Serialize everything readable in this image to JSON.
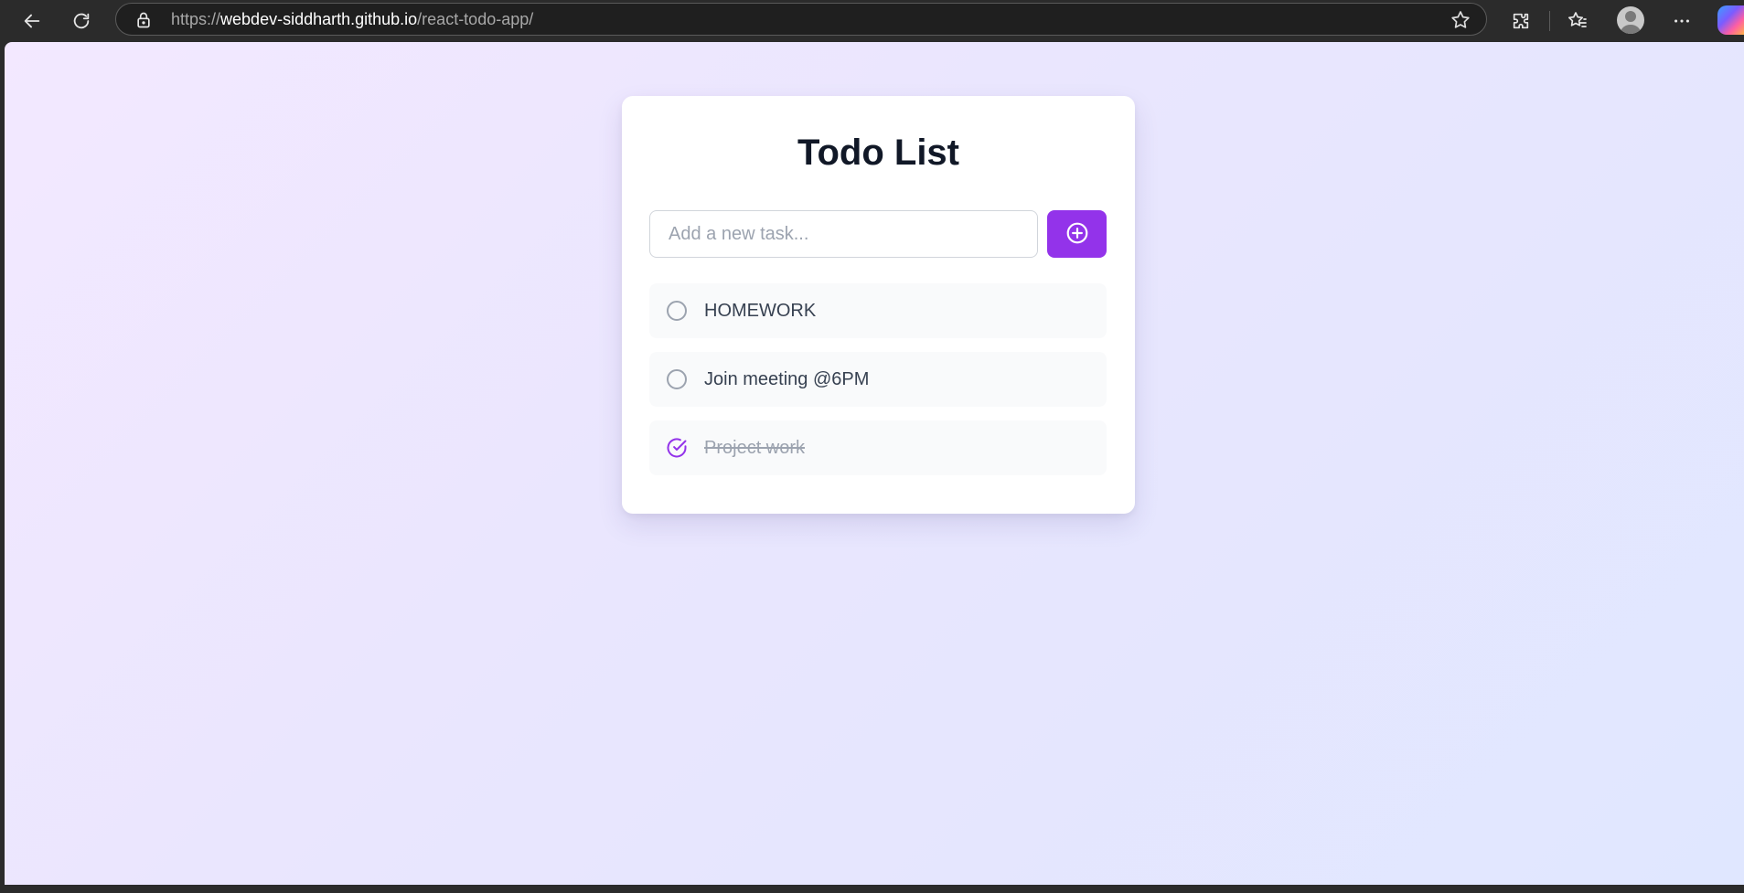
{
  "browser": {
    "url_scheme": "https://",
    "url_host": "webdev-siddharth.github.io",
    "url_path": "/react-todo-app/",
    "icons": [
      "back-icon",
      "refresh-icon",
      "lock-icon",
      "favorite-star-icon",
      "extensions-icon",
      "favorites-icon",
      "profile-avatar",
      "more-icon",
      "copilot-icon"
    ]
  },
  "app": {
    "title": "Todo List",
    "input": {
      "placeholder": "Add a new task...",
      "value": ""
    },
    "add_button_icon": "plus-circle-icon",
    "accent": "#9333ea",
    "todos": [
      {
        "text": "HOMEWORK",
        "completed": false
      },
      {
        "text": "Join meeting @6PM",
        "completed": false
      },
      {
        "text": "Project work",
        "completed": true
      }
    ]
  }
}
